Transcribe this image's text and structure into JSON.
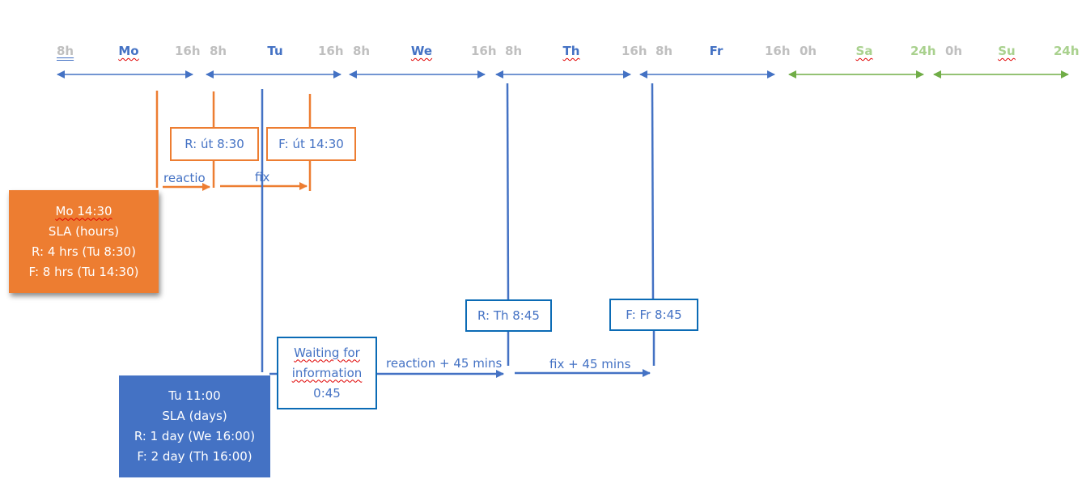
{
  "colors": {
    "workday_blue": "#4472c4",
    "weekend_green": "#70ad47",
    "hour_gray": "#bfbfbf",
    "weekend_label_green": "#a9d18e",
    "orange": "#ed7d31",
    "box_border_blue": "#0b6bb5"
  },
  "timeline": {
    "days": [
      {
        "label": "Mo",
        "start": "8h",
        "end": "16h",
        "weekend": false
      },
      {
        "label": "Tu",
        "start": "8h",
        "end": "16h",
        "weekend": false
      },
      {
        "label": "We",
        "start": "8h",
        "end": "16h",
        "weekend": false
      },
      {
        "label": "Th",
        "start": "8h",
        "end": "16h",
        "weekend": false
      },
      {
        "label": "Fr",
        "start": "8h",
        "end": "16h",
        "weekend": false
      },
      {
        "label": "Sa",
        "start": "0h",
        "end": "24h",
        "weekend": true
      },
      {
        "label": "Su",
        "start": "0h",
        "end": "24h",
        "weekend": true
      }
    ]
  },
  "hours_scenario": {
    "ticket_box": {
      "line1": "Mo 14:30",
      "line2": "SLA (hours)",
      "line3": "R: 4 hrs (Tu 8:30)",
      "line4": "F: 8 hrs (Tu 14:30)"
    },
    "reaction_marker": "R: út 8:30",
    "fix_marker": "F: út 14:30",
    "reaction_arrow_label": "reactio",
    "fix_arrow_label": "fix"
  },
  "days_scenario": {
    "ticket_box": {
      "line1": "Tu 11:00",
      "line2": "SLA (days)",
      "line3": "R: 1 day (We 16:00)",
      "line4": "F: 2 day (Th 16:00)"
    },
    "waiting_box": {
      "line1": "Waiting for",
      "line2": "information",
      "line3": "0:45"
    },
    "reaction_marker": "R: Th 8:45",
    "fix_marker": "F: Fr 8:45",
    "reaction_arrow_label": "reaction + 45 mins",
    "fix_arrow_label": "fix + 45 mins"
  }
}
